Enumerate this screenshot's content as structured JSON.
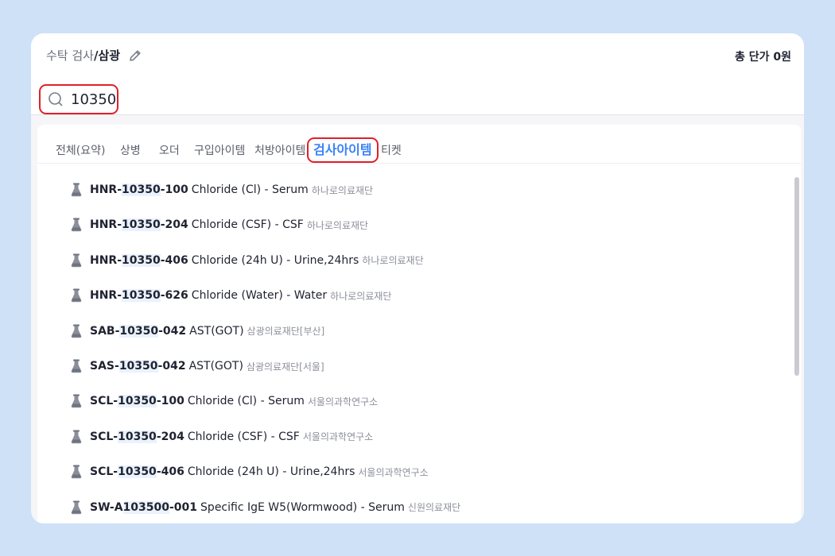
{
  "header": {
    "crumb_light": "수탁 검사",
    "crumb_sep": "/",
    "crumb_current": "삼광",
    "total_label": "총 단가 0원"
  },
  "search": {
    "value": "10350"
  },
  "tabs": [
    {
      "label": "전체(요약)"
    },
    {
      "label": "상병"
    },
    {
      "label": "오더"
    },
    {
      "label": "구입아이템"
    },
    {
      "label": "처방아이템"
    },
    {
      "label": "검사아이템"
    },
    {
      "label": "티켓"
    }
  ],
  "results": [
    {
      "pre": "HNR-",
      "hl": "10350",
      "post": "-100",
      "name": "Chloride (Cl) - Serum",
      "lab": "하나로의료재단"
    },
    {
      "pre": "HNR-",
      "hl": "10350",
      "post": "-204",
      "name": "Chloride (CSF) - CSF",
      "lab": "하나로의료재단"
    },
    {
      "pre": "HNR-",
      "hl": "10350",
      "post": "-406",
      "name": "Chloride (24h U) - Urine,24hrs",
      "lab": "하나로의료재단"
    },
    {
      "pre": "HNR-",
      "hl": "10350",
      "post": "-626",
      "name": "Chloride (Water) - Water",
      "lab": "하나로의료재단"
    },
    {
      "pre": "SAB-",
      "hl": "10350",
      "post": "-042",
      "name": "AST(GOT)",
      "lab": "삼광의료재단[부산]"
    },
    {
      "pre": "SAS-",
      "hl": "10350",
      "post": "-042",
      "name": "AST(GOT)",
      "lab": "삼광의료재단[서울]"
    },
    {
      "pre": "SCL-",
      "hl": "10350",
      "post": "-100",
      "name": "Chloride (Cl) - Serum",
      "lab": "서울의과학연구소"
    },
    {
      "pre": "SCL-",
      "hl": "10350",
      "post": "-204",
      "name": "Chloride (CSF) - CSF",
      "lab": "서울의과학연구소"
    },
    {
      "pre": "SCL-",
      "hl": "10350",
      "post": "-406",
      "name": "Chloride (24h U) - Urine,24hrs",
      "lab": "서울의과학연구소"
    },
    {
      "pre": "SW-A",
      "hl": "103500",
      "post": "-001",
      "name": "Specific IgE W5(Wormwood) - Serum",
      "lab": "신원의료재단"
    }
  ],
  "colors": {
    "accent": "#3b82f6",
    "highlight_border": "#e0202a",
    "background": "#cfe1f7"
  }
}
